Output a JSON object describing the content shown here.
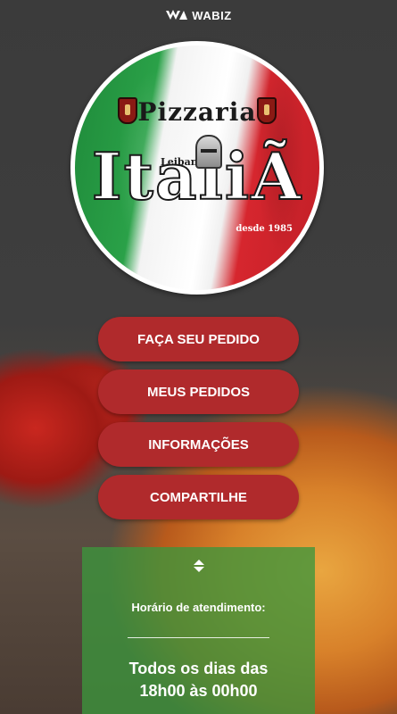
{
  "header": {
    "brand": "WABIZ",
    "brand_icon": "wabiz-logo-icon"
  },
  "logo": {
    "title_small": "Pizzaria",
    "title_big": "ItaliÃ",
    "subtitle": "Leibanti",
    "since": "desde 1985"
  },
  "menu": {
    "items": [
      {
        "label": "FAÇA SEU PEDIDO"
      },
      {
        "label": "MEUS PEDIDOS"
      },
      {
        "label": "INFORMAÇÕES"
      },
      {
        "label": "COMPARTILHE"
      }
    ]
  },
  "info": {
    "label": "Horário de atendimento:",
    "hours_line1": "Todos os dias das",
    "hours_line2": "18h00 às 00h00",
    "toggle_icon": "expand-collapse-icon"
  },
  "colors": {
    "button": "#b02a2c",
    "info_card": "#3c963c",
    "text": "#ffffff"
  }
}
